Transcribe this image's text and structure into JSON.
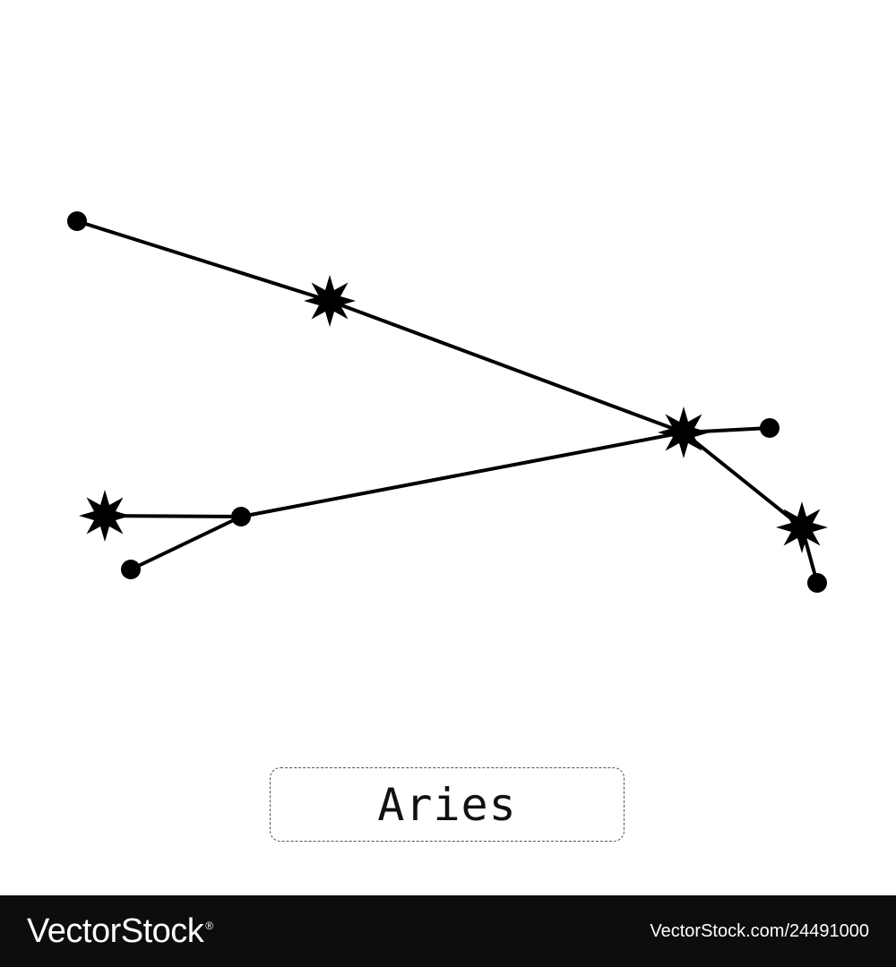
{
  "constellation": {
    "name": "Aries",
    "line_color": "#000000",
    "stars": [
      {
        "id": "s1",
        "kind": "dot"
      },
      {
        "id": "s2",
        "kind": "star"
      },
      {
        "id": "s3",
        "kind": "star"
      },
      {
        "id": "s4",
        "kind": "dot"
      },
      {
        "id": "s5",
        "kind": "star"
      },
      {
        "id": "s6",
        "kind": "dot"
      },
      {
        "id": "s7",
        "kind": "dot"
      },
      {
        "id": "s8",
        "kind": "star"
      },
      {
        "id": "s9",
        "kind": "dot"
      }
    ],
    "connections": [
      [
        "s1",
        "s2"
      ],
      [
        "s2",
        "s3"
      ],
      [
        "s3",
        "s4"
      ],
      [
        "s3",
        "s5"
      ],
      [
        "s5",
        "s6"
      ],
      [
        "s3",
        "s7"
      ],
      [
        "s7",
        "s8"
      ],
      [
        "s7",
        "s9"
      ]
    ]
  },
  "watermark": {
    "brand": "VectorStock",
    "registered": "®",
    "image_id": "VectorStock.com/24491000",
    "footer_color": "#0d0d0d"
  }
}
